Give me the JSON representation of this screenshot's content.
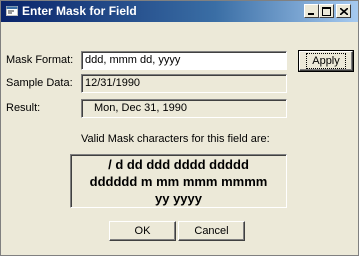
{
  "window": {
    "title": "Enter Mask for Field"
  },
  "titlebar_buttons": {
    "minimize_icon": "minimize-icon",
    "maximize_icon": "maximize-icon",
    "close_icon": "close-icon"
  },
  "form": {
    "mask_format_label": "Mask Format:",
    "mask_format_value": "ddd, mmm dd, yyyy",
    "apply_label": "Apply",
    "sample_data_label": "Sample Data:",
    "sample_data_value": "12/31/1990",
    "result_label": "Result:",
    "result_value": "Mon, Dec 31, 1990",
    "valid_chars_caption": "Valid Mask characters for this field are:",
    "valid_chars_lines": [
      "/ d dd ddd dddd ddddd",
      "dddddd m mm mmm mmmm",
      "yy yyyy"
    ]
  },
  "buttons": {
    "ok_label": "OK",
    "cancel_label": "Cancel"
  },
  "colors": {
    "titlebar_start": "#0a246a",
    "titlebar_end": "#a6caf0",
    "dialog_bg": "#ece9d8"
  }
}
